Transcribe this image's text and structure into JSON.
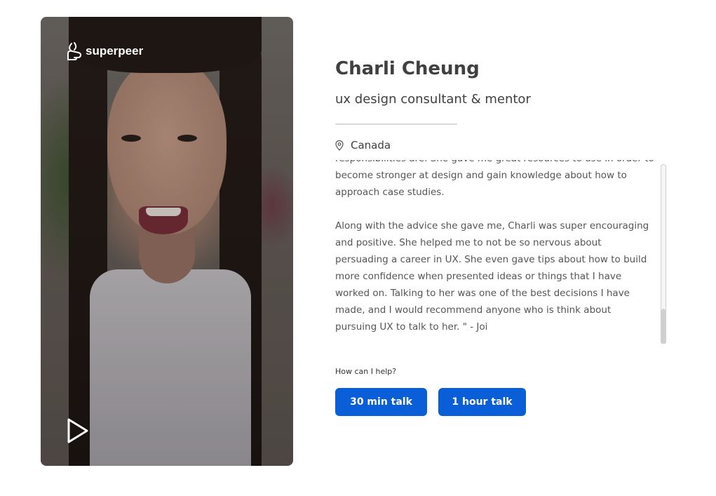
{
  "brand": {
    "name": "superpeer",
    "icon": "superpeer-logo-icon"
  },
  "video": {
    "play_icon": "play-icon"
  },
  "profile": {
    "name": "Charli Cheung",
    "tagline": "ux design consultant & mentor",
    "location": "Canada",
    "location_icon": "map-pin-icon"
  },
  "bio": {
    "paragraphs": [
      "responsibilities are. She gave me great resources to use in order to become stronger at design and gain knowledge about how to approach case studies.",
      "Along with the advice she gave me, Charli was super encouraging and positive. She helped me to not be so nervous about persuading a career in UX. She even gave tips about how to build more confidence when presented ideas or things that I have worked on. Talking to her was one of the best decisions I have made, and I would recommend anyone who is think about pursuing UX to talk to her. \" - Joi"
    ]
  },
  "help": {
    "label": "How can I help?",
    "options": [
      "30 min talk",
      "1 hour talk"
    ]
  },
  "colors": {
    "primary_button": "#0a5fd8",
    "heading": "#404040"
  }
}
